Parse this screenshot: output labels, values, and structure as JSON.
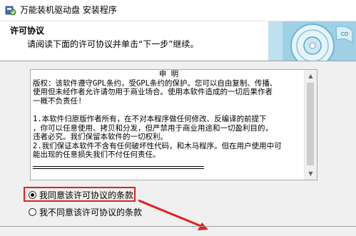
{
  "window": {
    "title": "万能装机驱动盘 安装程序"
  },
  "header": {
    "title": "许可协议",
    "subtitle": "请阅读下面的许可协议并单击“下一步”继续。"
  },
  "license": {
    "heading": "申 明",
    "lines": [
      "版权：该软件遵守GPL条约，受GPL条约的保护。您可以自由复制、传播、",
      "使用但未经作者允许请勿用于商业场合。使用本软件造成的一切后果作者",
      "一概不负责任!",
      "",
      "1.本软件归原版作者所有，在不对本程序做任何修改、反编译的前提下",
      "，你可以任意使用、拷贝和分发，但严禁用于商业用途和一切盈利目的，",
      "违者必究。我们保留本软件的一切权利。",
      "2.我们保证本软件不含有任何破坏性代码，和木马程序。但在用户使用中可",
      "能出现的任意损失我们不付任何责任。"
    ]
  },
  "options": {
    "agree": "我同意该许可协议的条款",
    "disagree": "我不同意该许可协议的条款"
  },
  "colors": {
    "highlight": "#e02020"
  }
}
